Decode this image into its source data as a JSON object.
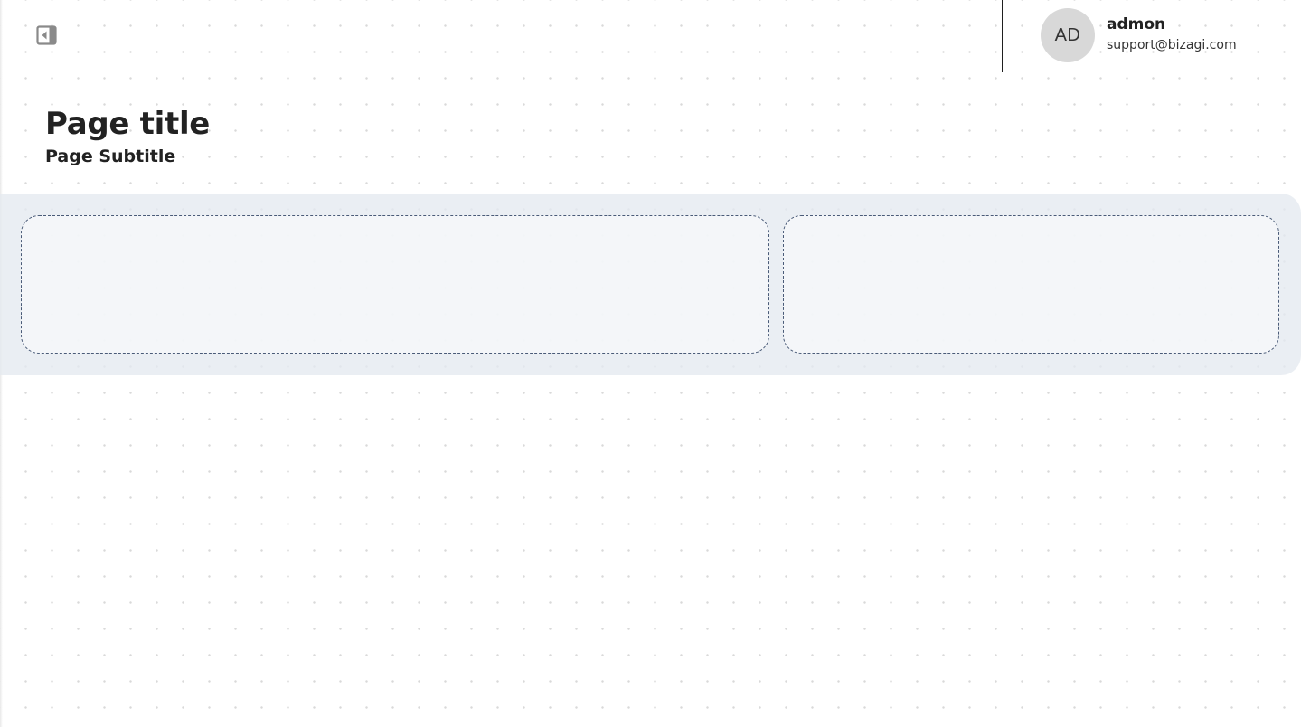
{
  "header": {
    "toggle_icon": "collapse-sidebar-icon",
    "user": {
      "initials": "AD",
      "name": "admon",
      "email": "support@bizagi.com"
    }
  },
  "page": {
    "title": "Page title",
    "subtitle": "Page Subtitle"
  },
  "colors": {
    "background": "#ffffff",
    "dot_grid": "#d9d9d9",
    "band": "#e9edf3",
    "zone_border": "#4a5b78",
    "avatar_bg": "#d8d8d8",
    "text": "#222222"
  }
}
